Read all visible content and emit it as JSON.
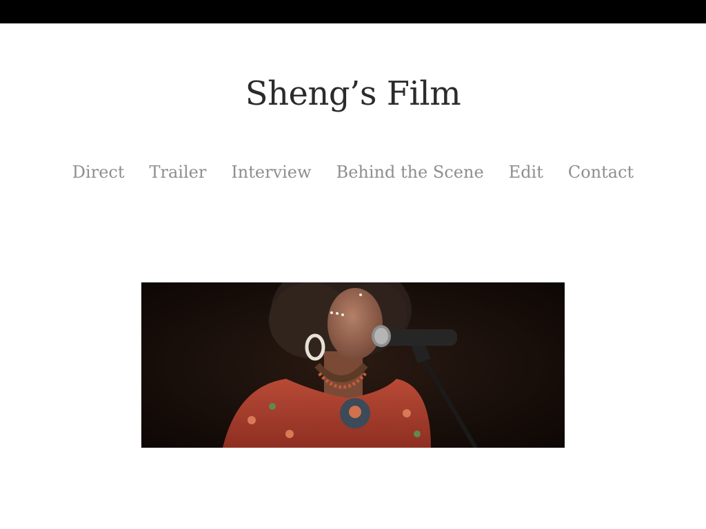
{
  "site": {
    "title": "Sheng’s Film"
  },
  "nav": {
    "items": [
      {
        "label": "Direct"
      },
      {
        "label": "Trailer"
      },
      {
        "label": "Interview"
      },
      {
        "label": "Behind the Scene"
      },
      {
        "label": "Edit"
      },
      {
        "label": "Contact"
      }
    ]
  },
  "colors": {
    "topbar": "#000000",
    "title": "#2b2b2b",
    "nav_link": "#8e8e8e",
    "background": "#ffffff"
  }
}
